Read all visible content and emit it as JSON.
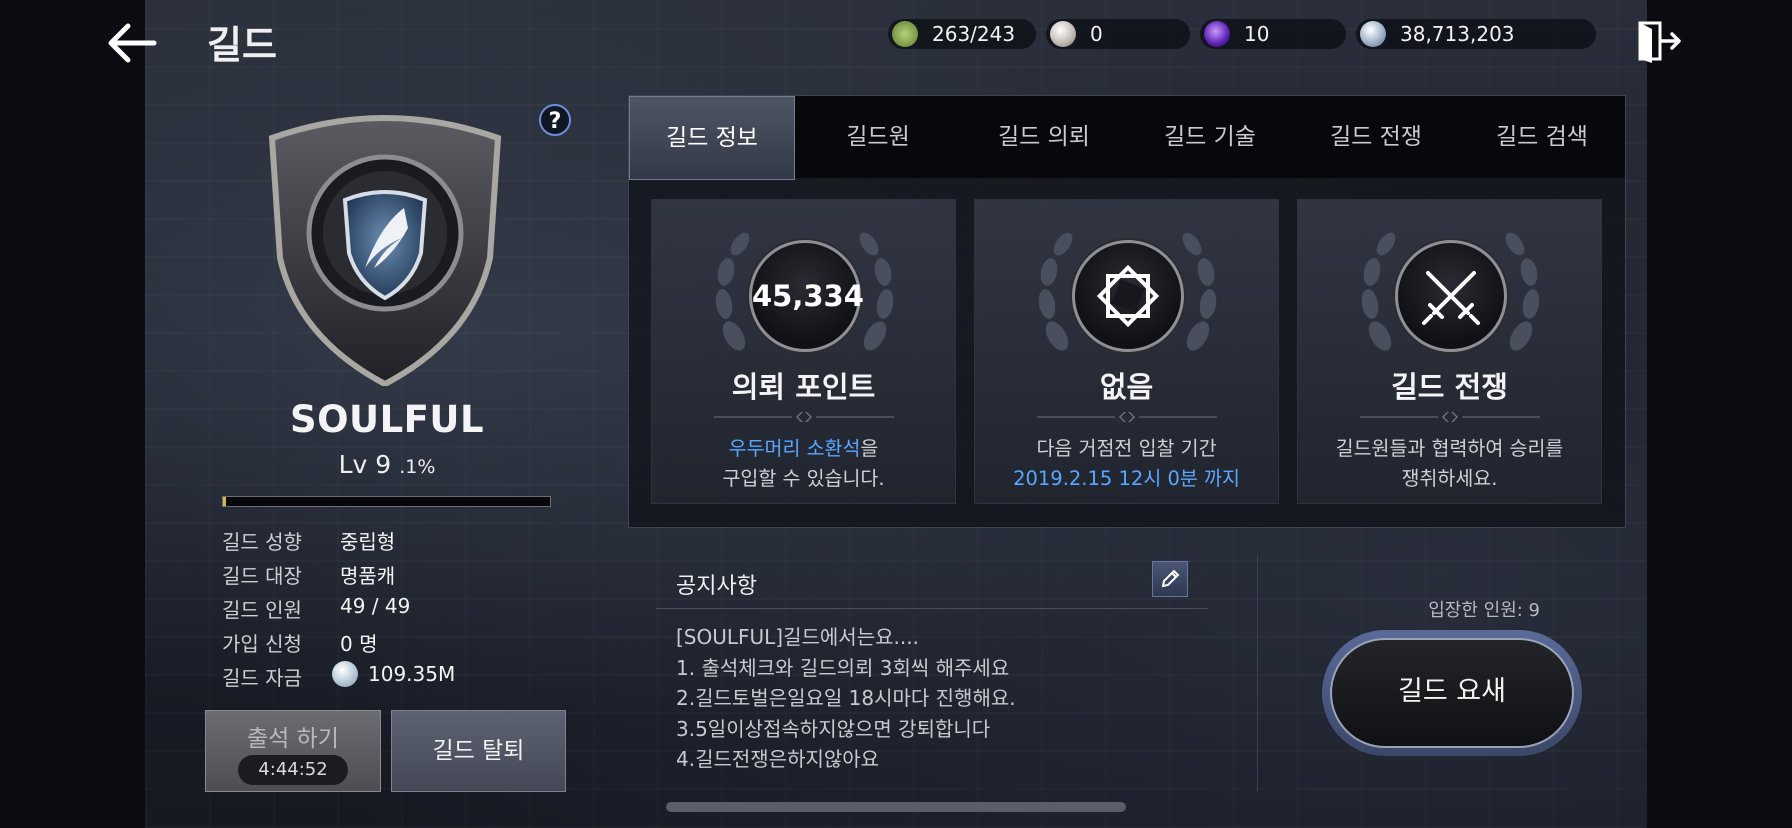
{
  "header": {
    "title": "길드"
  },
  "resources": [
    {
      "name": "energy",
      "value": "263/243",
      "color": "#8fae5a"
    },
    {
      "name": "pearl",
      "value": "0",
      "color": "#d7d2cc"
    },
    {
      "name": "purple-gem",
      "value": "10",
      "color": "#7a3fd6"
    },
    {
      "name": "silver",
      "value": "38,713,203",
      "color": "#b9c9da"
    }
  ],
  "guild": {
    "name": "SOULFUL",
    "level": "Lv 9",
    "progress_text": ".1%",
    "progress": 0.01,
    "info": [
      {
        "key": "길드 성향",
        "value": "중립형"
      },
      {
        "key": "길드 대장",
        "value": "명품캐"
      },
      {
        "key": "길드 인원",
        "value": "49 / 49"
      },
      {
        "key": "가입 신청",
        "value": "0 명"
      },
      {
        "key": "길드 자금",
        "value": "109.35M"
      }
    ],
    "attendance_label": "출석 하기",
    "attendance_timer": "4:44:52",
    "leave_label": "길드 탈퇴",
    "help_label": "?"
  },
  "tabs": [
    "길드 정보",
    "길드원",
    "길드 의뢰",
    "길드 기술",
    "길드 전쟁",
    "길드 검색"
  ],
  "active_tab": "길드 정보",
  "cards": [
    {
      "medal_value": "45,334",
      "icon": "points-medal",
      "title": "의뢰 포인트",
      "line1_highlight": "우두머리 소환석",
      "line1_rest": "을",
      "line2": "구입할 수 있습니다."
    },
    {
      "icon": "diamond-frame-icon",
      "title": "없음",
      "line1": "다음 거점전 입찰 기간",
      "line2_highlight": "2019.2.15 12시 0분 까지"
    },
    {
      "icon": "crossed-swords-icon",
      "title": "길드 전쟁",
      "line1": "길드원들과 협력하여 승리를",
      "line2": "쟁취하세요."
    }
  ],
  "notice": {
    "title": "공지사항",
    "lines": [
      "[SOULFUL]길드에서는요....",
      "1. 출석체크와 길드의뢰 3회씩 해주세요",
      "2.길드토벌은일요일 18시마다 진행해요.",
      "3.5일이상접속하지않으면 강퇴합니다",
      "4.길드전쟁은하지않아요"
    ]
  },
  "fortress": {
    "entered_label": "입장한 인원: 9",
    "button_label": "길드 요새"
  },
  "colors": {
    "accent_blue": "#59a7ff",
    "xp_fill": "#d8b24a"
  }
}
